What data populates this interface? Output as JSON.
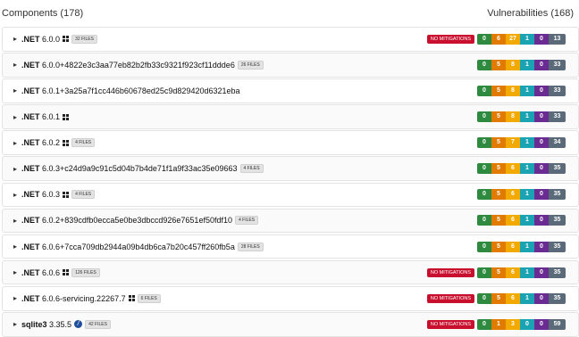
{
  "header": {
    "components_label": "Components (178)",
    "vulnerabilities_label": "Vulnerabilities (168)"
  },
  "colors": {
    "no_mitigations": "#c8102e",
    "severity": [
      "#2d8a3e",
      "#e07b00",
      "#f2a900",
      "#1aa3b3",
      "#6a2b92"
    ],
    "total": "#5b6a78"
  },
  "components": [
    {
      "name": ".NET",
      "version": "6.0.0",
      "icon": "windows-icon",
      "files": "32 FILES",
      "mitigation": "NO MITIGATIONS",
      "counts": [
        "0",
        "6",
        "27",
        "1",
        "0",
        "13"
      ]
    },
    {
      "name": ".NET",
      "version": "6.0.0+4822e3c3aa77eb82b2fb33c9321f923cf11ddde6",
      "icon": "",
      "files": "26 FILES",
      "mitigation": "",
      "counts": [
        "0",
        "5",
        "8",
        "1",
        "0",
        "33"
      ]
    },
    {
      "name": ".NET",
      "version": "6.0.1+3a25a7f1cc446b60678ed25c9d829420d6321eba",
      "icon": "",
      "files": "",
      "mitigation": "",
      "counts": [
        "0",
        "5",
        "8",
        "1",
        "0",
        "33"
      ]
    },
    {
      "name": ".NET",
      "version": "6.0.1",
      "icon": "windows-icon",
      "files": "",
      "mitigation": "",
      "counts": [
        "0",
        "5",
        "8",
        "1",
        "0",
        "33"
      ]
    },
    {
      "name": ".NET",
      "version": "6.0.2",
      "icon": "windows-icon",
      "files": "4 FILES",
      "mitigation": "",
      "counts": [
        "0",
        "5",
        "7",
        "1",
        "0",
        "34"
      ]
    },
    {
      "name": ".NET",
      "version": "6.0.3+c24d9a9c91c5d04b7b4de71f1a9f33ac35e09663",
      "icon": "",
      "files": "4 FILES",
      "mitigation": "",
      "counts": [
        "0",
        "5",
        "6",
        "1",
        "0",
        "35"
      ]
    },
    {
      "name": ".NET",
      "version": "6.0.3",
      "icon": "windows-icon",
      "files": "4 FILES",
      "mitigation": "",
      "counts": [
        "0",
        "5",
        "6",
        "1",
        "0",
        "35"
      ]
    },
    {
      "name": ".NET",
      "version": "6.0.2+839cdfb0ecca5e0be3dbccd926e7651ef50fdf10",
      "icon": "",
      "files": "4 FILES",
      "mitigation": "",
      "counts": [
        "0",
        "5",
        "6",
        "1",
        "0",
        "35"
      ]
    },
    {
      "name": ".NET",
      "version": "6.0.6+7cca709db2944a09b4db6ca7b20c457ff260fb5a",
      "icon": "",
      "files": "28 FILES",
      "mitigation": "",
      "counts": [
        "0",
        "5",
        "6",
        "1",
        "0",
        "35"
      ]
    },
    {
      "name": ".NET",
      "version": "6.0.6",
      "icon": "windows-icon",
      "files": "126 FILES",
      "mitigation": "NO MITIGATIONS",
      "counts": [
        "0",
        "5",
        "6",
        "1",
        "0",
        "35"
      ]
    },
    {
      "name": ".NET",
      "version": "6.0.6-servicing.22267.7",
      "icon": "windows-icon",
      "files": "6 FILES",
      "mitigation": "NO MITIGATIONS",
      "counts": [
        "0",
        "5",
        "6",
        "1",
        "0",
        "35"
      ]
    },
    {
      "name": "sqlite3",
      "version": "3.35.5",
      "icon": "edge-icon",
      "files": "42 FILES",
      "mitigation": "NO MITIGATIONS",
      "counts": [
        "0",
        "1",
        "3",
        "0",
        "0",
        "59"
      ]
    }
  ]
}
